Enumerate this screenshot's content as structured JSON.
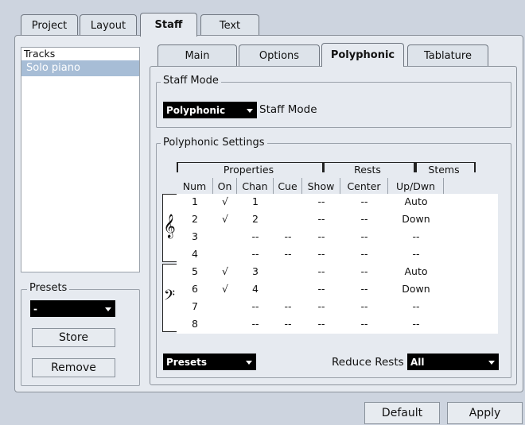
{
  "top_tabs": [
    "Project",
    "Layout",
    "Staff",
    "Text"
  ],
  "active_top_tab": "Staff",
  "sub_tabs": [
    "Main",
    "Options",
    "Polyphonic",
    "Tablature"
  ],
  "active_sub_tab": "Polyphonic",
  "tracks": {
    "header": "Tracks",
    "items": [
      "Solo piano"
    ]
  },
  "presets_group": {
    "label": "Presets",
    "selected": "-",
    "store_label": "Store",
    "remove_label": "Remove"
  },
  "staff_mode": {
    "group_label": "Staff Mode",
    "selected": "Polyphonic",
    "field_label": "Staff Mode"
  },
  "poly_settings": {
    "group_label": "Polyphonic Settings",
    "group_headers": {
      "properties": "Properties",
      "rests": "Rests",
      "stems": "Stems"
    },
    "columns": [
      "Num",
      "On",
      "Chan",
      "Cue",
      "Show",
      "Center",
      "Up/Dwn"
    ],
    "rows": [
      {
        "num": "1",
        "on": "√",
        "chan": "1",
        "cue": "",
        "show": "--",
        "center": "--",
        "stem": "Auto"
      },
      {
        "num": "2",
        "on": "√",
        "chan": "2",
        "cue": "",
        "show": "--",
        "center": "--",
        "stem": "Down"
      },
      {
        "num": "3",
        "on": "",
        "chan": "--",
        "cue": "--",
        "show": "--",
        "center": "--",
        "stem": "--"
      },
      {
        "num": "4",
        "on": "",
        "chan": "--",
        "cue": "--",
        "show": "--",
        "center": "--",
        "stem": "--"
      },
      {
        "num": "5",
        "on": "√",
        "chan": "3",
        "cue": "",
        "show": "--",
        "center": "--",
        "stem": "Auto"
      },
      {
        "num": "6",
        "on": "√",
        "chan": "4",
        "cue": "",
        "show": "--",
        "center": "--",
        "stem": "Down"
      },
      {
        "num": "7",
        "on": "",
        "chan": "--",
        "cue": "--",
        "show": "--",
        "center": "--",
        "stem": "--"
      },
      {
        "num": "8",
        "on": "",
        "chan": "--",
        "cue": "--",
        "show": "--",
        "center": "--",
        "stem": "--"
      }
    ],
    "treble_clef": "𝄞",
    "bass_clef": "𝄢",
    "presets_dropdown": "Presets",
    "reduce_rests_label": "Reduce Rests",
    "reduce_rests_value": "All"
  },
  "footer": {
    "default_label": "Default",
    "apply_label": "Apply"
  }
}
